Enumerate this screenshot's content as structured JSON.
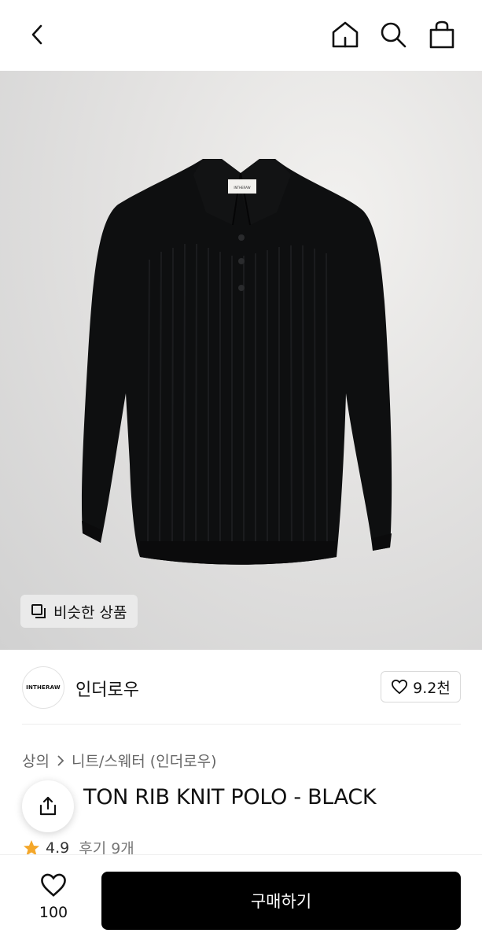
{
  "header": {
    "icons": [
      "back-icon",
      "home-icon",
      "search-icon",
      "shopping-bag-icon"
    ]
  },
  "hero": {
    "similar_label": "비슷한 상품",
    "tag_text": "INTHERAW"
  },
  "brand": {
    "logo_text": "INTHERAW",
    "name": "인더로우",
    "like_count": "9.2천"
  },
  "breadcrumb": {
    "category": "상의",
    "subcategory": "니트/스웨터 (인더로우)"
  },
  "product": {
    "title_visible": "TON RIB KNIT POLO - BLACK",
    "rating": "4.9",
    "reviews": "후기 9개"
  },
  "bottom_bar": {
    "wish_count": "100",
    "buy_label": "구매하기"
  },
  "colors": {
    "buy_button": "#000000",
    "star": "#f4a72a"
  }
}
